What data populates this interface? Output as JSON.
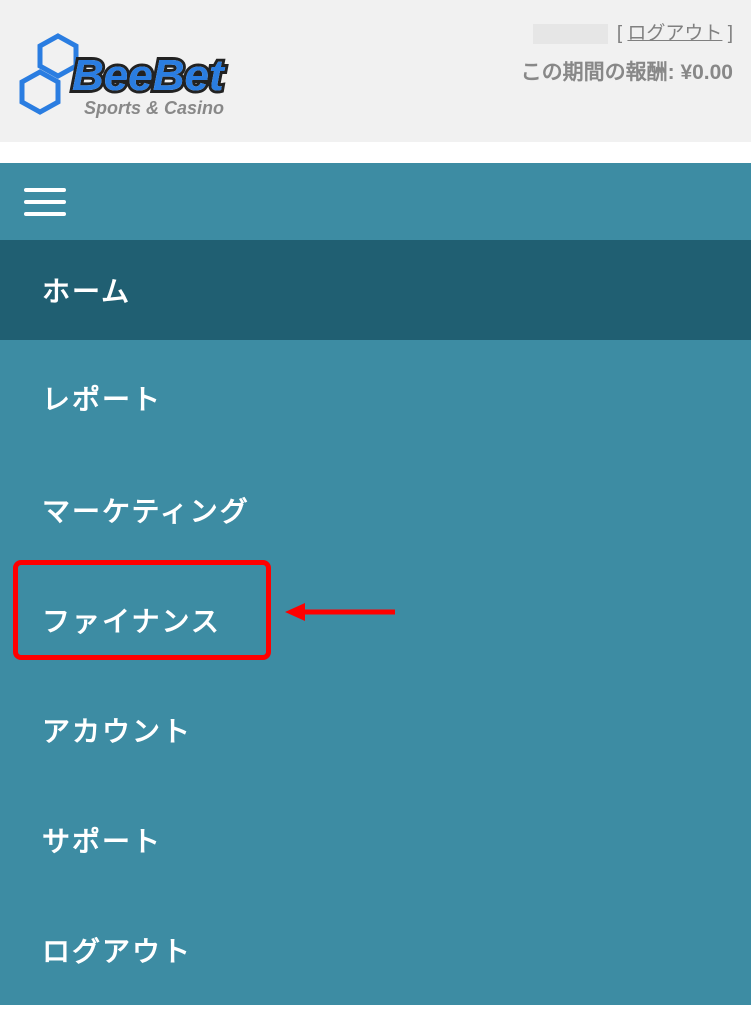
{
  "header": {
    "logout_open_bracket": "[ ",
    "logout_label": "ログアウト",
    "logout_close_bracket": " ]",
    "reward_label": "この期間の報酬:",
    "reward_value": "¥0.00"
  },
  "logo": {
    "brand_main": "BeeBet",
    "brand_sub": "Sports & Casino"
  },
  "nav": {
    "items": [
      {
        "label": "ホーム",
        "active": true
      },
      {
        "label": "レポート",
        "active": false
      },
      {
        "label": "マーケティング",
        "active": false
      },
      {
        "label": "ファイナンス",
        "active": false
      },
      {
        "label": "アカウント",
        "active": false
      },
      {
        "label": "サポート",
        "active": false
      },
      {
        "label": "ログアウト",
        "active": false
      }
    ]
  },
  "annotation": {
    "highlighted_item_index": 3
  }
}
